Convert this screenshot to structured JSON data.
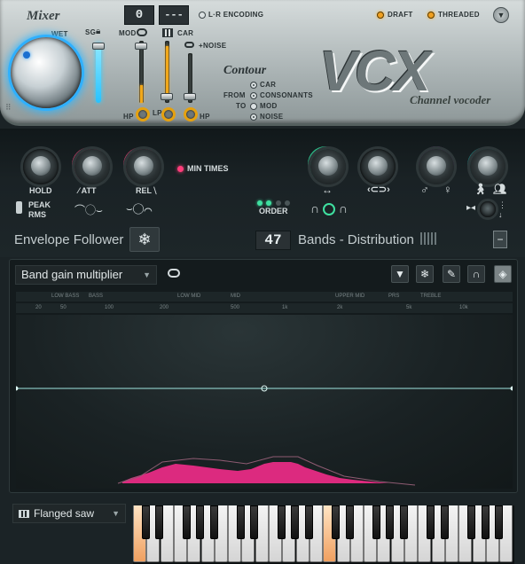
{
  "mixer": {
    "title": "Mixer",
    "wet_label": "WET",
    "sg_label": "SG",
    "mod_label": "MOD",
    "car_label": "CAR",
    "noise_label": "+NOISE",
    "hp_label": "HP",
    "lp_label": "LP",
    "hp2_label": "HP"
  },
  "lcd": {
    "value_a": "0",
    "value_b": "---"
  },
  "lr_encoding": {
    "label": "L·R ENCODING",
    "on": false
  },
  "options": {
    "draft_label": "DRAFT",
    "threaded_label": "THREADED"
  },
  "contour": {
    "title": "Contour",
    "from_label": "FROM",
    "to_label": "TO",
    "from_options": [
      {
        "label": "CAR",
        "selected": true
      },
      {
        "label": "CONSONANTS",
        "selected": true
      }
    ],
    "to_options": [
      {
        "label": "MOD",
        "selected": false
      },
      {
        "label": "NOISE",
        "selected": true
      }
    ]
  },
  "logo": {
    "text": "VCX",
    "subtitle": "Channel vocoder"
  },
  "envelope": {
    "title": "Envelope Follower",
    "hold_label": "HOLD",
    "att_label": "ATT",
    "rel_label": "REL",
    "min_times_label": "MIN TIMES",
    "peak_label": "PEAK",
    "rms_label": "RMS"
  },
  "bands": {
    "title": "Bands - Distribution",
    "count": "47",
    "order_label": "ORDER"
  },
  "editor": {
    "selector": "Band gain multiplier",
    "band_names": [
      "LOW BASS",
      "BASS",
      "LOW MID",
      "MID",
      "UPPER MID",
      "PRS",
      "TREBLE"
    ],
    "freq_ticks": [
      "20",
      "50",
      "100",
      "200",
      "500",
      "1k",
      "2k",
      "5k",
      "10k"
    ]
  },
  "instrument": {
    "preset": "Flanged saw"
  },
  "colors": {
    "accent_blue": "#31b8ff",
    "accent_orange": "#f0a020",
    "pink": "#ff2d8f",
    "teal_line": "#9fe6e0"
  }
}
